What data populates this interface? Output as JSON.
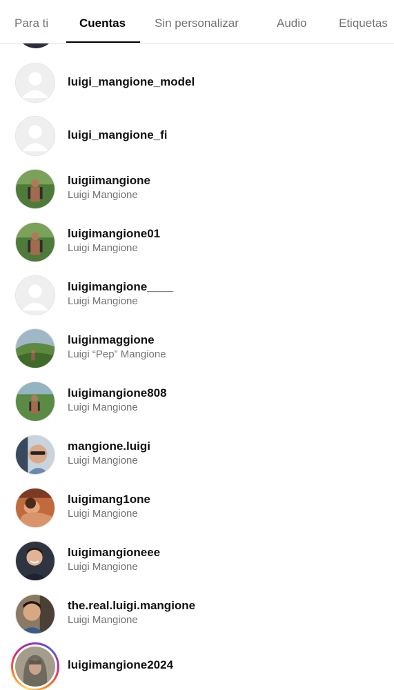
{
  "tabs": [
    {
      "label": "Para ti",
      "active": false
    },
    {
      "label": "Cuentas",
      "active": true
    },
    {
      "label": "Sin personalizar",
      "active": false
    },
    {
      "label": "Audio",
      "active": false
    },
    {
      "label": "Etiquetas",
      "active": false
    }
  ],
  "accounts": [
    {
      "username": "luigi_mangione_model",
      "fullname": "",
      "avatar": "default-avatar"
    },
    {
      "username": "luigi_mangione_fi",
      "fullname": "",
      "avatar": "default-avatar"
    },
    {
      "username": "luigiimangione",
      "fullname": "Luigi Mangione",
      "avatar": "hiker-photo"
    },
    {
      "username": "luigimangione01",
      "fullname": "Luigi Mangione",
      "avatar": "hiker-photo"
    },
    {
      "username": "luigimangione____",
      "fullname": "Luigi Mangione",
      "avatar": "default-avatar"
    },
    {
      "username": "luiginmaggione",
      "fullname": "Luigi “Pep” Mangione",
      "avatar": "landscape-photo"
    },
    {
      "username": "luigimangione808",
      "fullname": "Luigi Mangione",
      "avatar": "hiker-photo"
    },
    {
      "username": "mangione.luigi",
      "fullname": "Luigi Mangione",
      "avatar": "man-sunglasses-photo"
    },
    {
      "username": "luigimang1one",
      "fullname": "Luigi Mangione",
      "avatar": "reclining-man-photo"
    },
    {
      "username": "luigimangioneee",
      "fullname": "Luigi Mangione",
      "avatar": "smiling-man-photo"
    },
    {
      "username": "the.real.luigi.mangione",
      "fullname": "Luigi Mangione",
      "avatar": "selfie-photo"
    },
    {
      "username": "luigimangione2024",
      "fullname": "",
      "avatar": "hooded-man-photo",
      "story": true
    }
  ],
  "colors": {
    "active_tab": "#000000",
    "inactive_tab": "#737373",
    "secondary_text": "#737373",
    "divider": "#dbdbdb"
  }
}
